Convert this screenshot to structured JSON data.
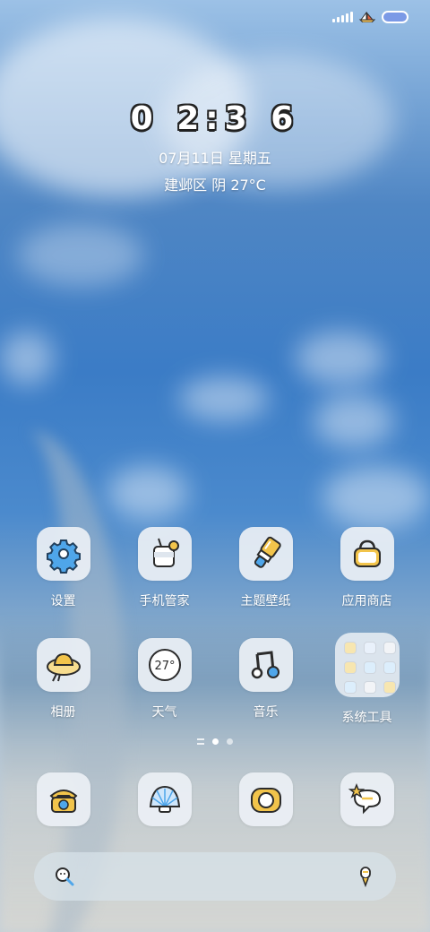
{
  "status_bar": {
    "signal_icon": "signal-icon",
    "boat_icon": "sailboat-icon",
    "battery_icon": "battery-icon"
  },
  "clock": {
    "time": "0 2:3 6",
    "date": "07月11日 星期五",
    "weather": "建邺区 阴 27°C"
  },
  "apps": [
    {
      "label": "设置",
      "icon": "gear-icon"
    },
    {
      "label": "手机管家",
      "icon": "cup-icon"
    },
    {
      "label": "主题壁纸",
      "icon": "paintbrush-icon"
    },
    {
      "label": "应用商店",
      "icon": "bag-icon"
    },
    {
      "label": "相册",
      "icon": "hat-icon"
    },
    {
      "label": "天气",
      "icon": "weather-badge-icon",
      "badge_text": "27°"
    },
    {
      "label": "音乐",
      "icon": "music-note-icon"
    },
    {
      "label": "系统工具",
      "icon": "folder-icon"
    }
  ],
  "page_indicator": {
    "pages": 2,
    "active": 1
  },
  "dock": [
    {
      "icon": "telephone-icon"
    },
    {
      "icon": "shell-icon"
    },
    {
      "icon": "camera-icon"
    },
    {
      "icon": "message-icon"
    }
  ],
  "search_bar": {
    "left_icon": "search-icon",
    "right_icon": "microphone-icon"
  },
  "colors": {
    "accent_blue": "#3b8fe0",
    "accent_yellow": "#f2c44b",
    "tile_bg": "#ebf0f5"
  }
}
